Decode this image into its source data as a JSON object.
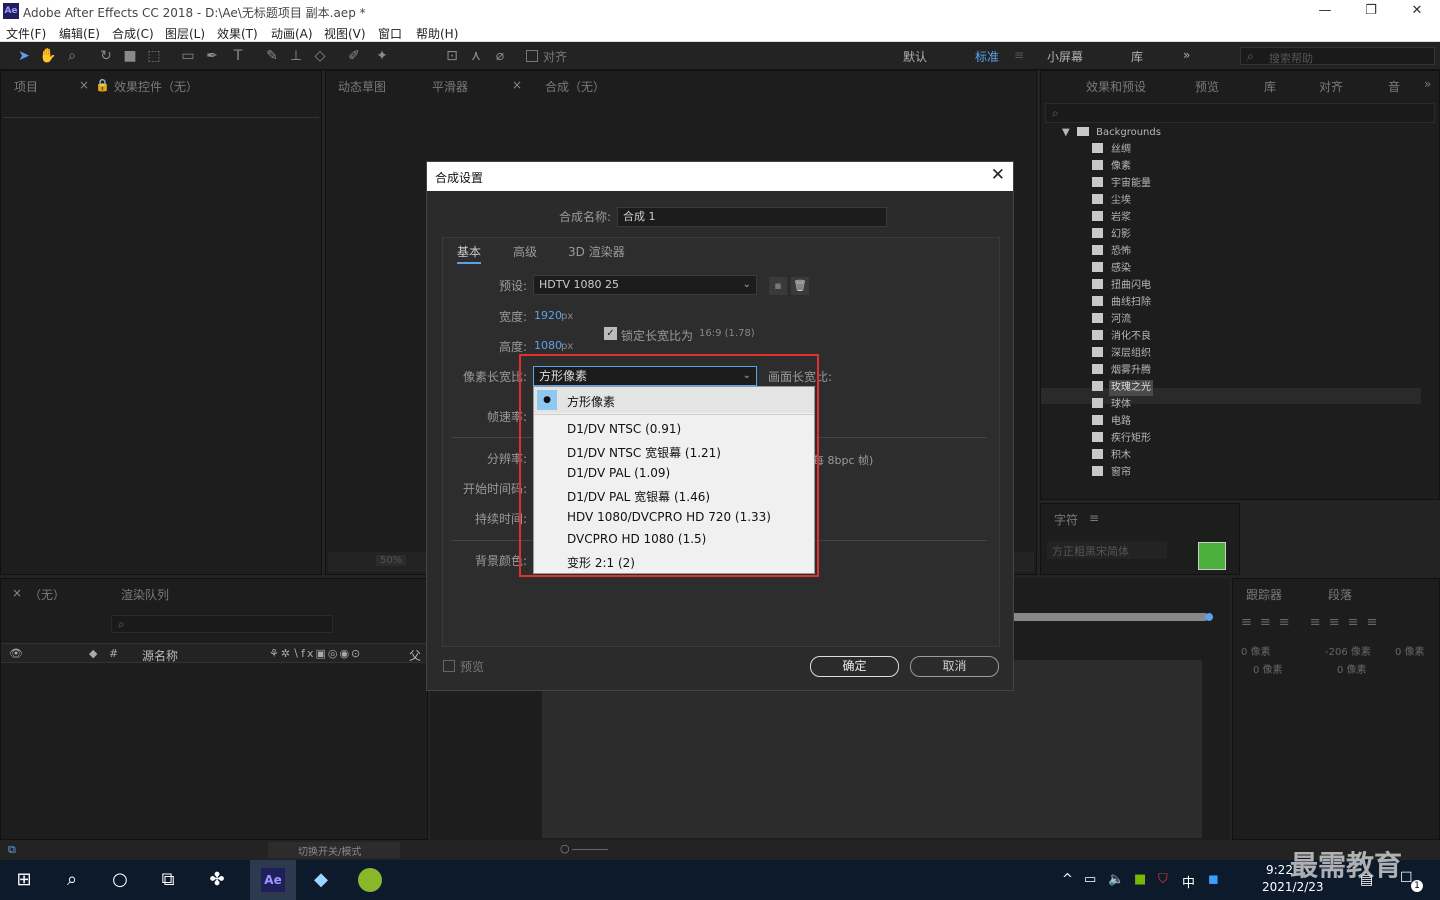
{
  "app": {
    "title": "Adobe After Effects CC 2018 - D:\\Ae\\无标题项目 副本.aep *",
    "logo": "Ae"
  },
  "menu": [
    "文件(F)",
    "编辑(E)",
    "合成(C)",
    "图层(L)",
    "效果(T)",
    "动画(A)",
    "视图(V)",
    "窗口",
    "帮助(H)"
  ],
  "toolbar": {
    "snap_label": "对齐",
    "workspaces": [
      "默认",
      "标准",
      "小屏幕",
      "库"
    ],
    "active_workspace": "标准",
    "search_placeholder": "搜索帮助"
  },
  "project_panel": {
    "tab_project": "项目",
    "tab_effects_controls": "效果控件（无）"
  },
  "viewer": {
    "tabs": [
      "动态草图",
      "平滑器",
      "合成（无）"
    ],
    "zoom": "50%"
  },
  "effects_panel": {
    "tabs": [
      "效果和预设",
      "预览",
      "库",
      "对齐",
      "音"
    ],
    "folder": "Backgrounds",
    "items": [
      "丝绸",
      "像素",
      "宇宙能量",
      "尘埃",
      "岩浆",
      "幻影",
      "恐怖",
      "感染",
      "扭曲闪电",
      "曲线扫除",
      "河流",
      "消化不良",
      "深层组织",
      "烟雾升腾",
      "玫瑰之光",
      "球体",
      "电路",
      "疾行矩形",
      "积木",
      "窗帘"
    ],
    "selected": "玫瑰之光"
  },
  "character_panel": {
    "tab": "字符",
    "font": "方正粗黑宋简体"
  },
  "tracker_panel": {
    "tabs": [
      "跟踪器",
      "段落"
    ],
    "indent_values": [
      "0 像素",
      "-206 像素",
      "0 像素",
      "0 像素",
      "0 像素"
    ]
  },
  "timeline": {
    "tab_none": "（无）",
    "tab_render": "渲染队列",
    "col_source": "源名称",
    "col_parent": "父",
    "toggle_modes": "切换开关/模式"
  },
  "dialog": {
    "title": "合成设置",
    "comp_name_label": "合成名称:",
    "comp_name": "合成 1",
    "tabs": [
      "基本",
      "高级",
      "3D 渲染器"
    ],
    "preset_label": "预设:",
    "preset": "HDTV 1080 25",
    "width_label": "宽度:",
    "width": "1920",
    "height_label": "高度:",
    "height": "1080",
    "unit": "px",
    "lock_aspect": "锁定长宽比为",
    "lock_ratio": "16:9 (1.78)",
    "pixel_aspect_label": "像素长宽比:",
    "pixel_aspect": "方形像素",
    "frame_aspect_label": "画面长宽比:",
    "frame_rate_label": "帧速率:",
    "resolution_label": "分辨率:",
    "resolution_tail": "每 8bpc 帧)",
    "start_tc_label": "开始时间码:",
    "duration_label": "持续时间:",
    "bg_color_label": "背景颜色:",
    "preview": "预览",
    "ok": "确定",
    "cancel": "取消"
  },
  "pixel_aspect_options": [
    "方形像素",
    "D1/DV NTSC (0.91)",
    "D1/DV NTSC 宽银幕 (1.21)",
    "D1/DV PAL (1.09)",
    "D1/DV PAL 宽银幕 (1.46)",
    "HDV 1080/DVCPRO HD 720 (1.33)",
    "DVCPRO HD 1080 (1.5)",
    "变形 2:1 (2)"
  ],
  "taskbar": {
    "time": "9:22",
    "date": "2021/2/23",
    "ime": "中",
    "notification_count": "1",
    "watermark": "最需教育"
  },
  "colors": {
    "accent": "#5ba2e8",
    "highlight": "#e03030",
    "fill_swatch": "#4caf3c"
  }
}
